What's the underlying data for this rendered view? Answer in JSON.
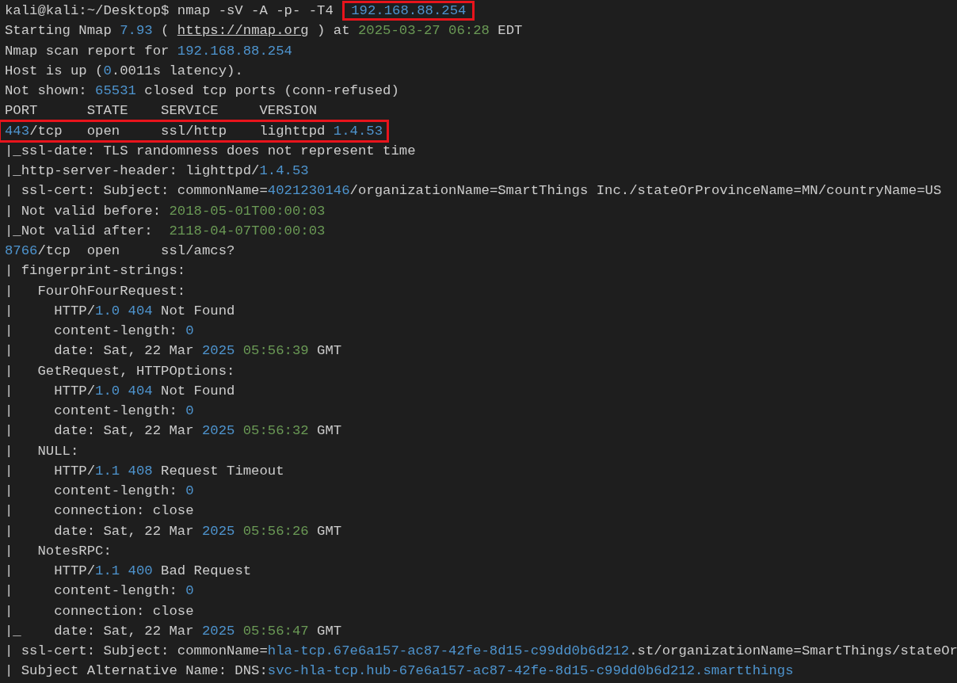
{
  "terminal": {
    "lines": [
      {
        "boxed": false,
        "segments": [
          {
            "text": "kali@kali:~/Desktop$ nmap -sV -A -p- -T4 ",
            "kind": "plain"
          },
          {
            "text": "192.168.88.254",
            "kind": "number",
            "boxed": true
          }
        ]
      },
      {
        "boxed": false,
        "segments": [
          {
            "text": "Starting Nmap ",
            "kind": "plain"
          },
          {
            "text": "7.93",
            "kind": "number"
          },
          {
            "text": " ( ",
            "kind": "plain"
          },
          {
            "text": "https://nmap.org",
            "kind": "link"
          },
          {
            "text": " ) at ",
            "kind": "plain"
          },
          {
            "text": "2025-03-27 06:28",
            "kind": "date"
          },
          {
            "text": " EDT",
            "kind": "plain"
          }
        ]
      },
      {
        "boxed": false,
        "segments": [
          {
            "text": "Nmap scan report for ",
            "kind": "plain"
          },
          {
            "text": "192.168.88.254",
            "kind": "number"
          }
        ]
      },
      {
        "boxed": false,
        "segments": [
          {
            "text": "Host is up (",
            "kind": "plain"
          },
          {
            "text": "0",
            "kind": "number"
          },
          {
            "text": ".0011s latency).",
            "kind": "plain"
          }
        ]
      },
      {
        "boxed": false,
        "segments": [
          {
            "text": "Not shown: ",
            "kind": "plain"
          },
          {
            "text": "65531",
            "kind": "number"
          },
          {
            "text": " closed tcp ports (conn-refused)",
            "kind": "plain"
          }
        ]
      },
      {
        "boxed": false,
        "segments": [
          {
            "text": "PORT      STATE    SERVICE     VERSION",
            "kind": "plain"
          }
        ]
      },
      {
        "boxed": true,
        "segments": [
          {
            "text": "443",
            "kind": "number"
          },
          {
            "text": "/tcp   open     ssl/http    lighttpd ",
            "kind": "plain"
          },
          {
            "text": "1.4.53",
            "kind": "number"
          }
        ]
      },
      {
        "boxed": false,
        "segments": [
          {
            "text": "|_ssl-date: TLS randomness does not represent time",
            "kind": "plain"
          }
        ]
      },
      {
        "boxed": false,
        "segments": [
          {
            "text": "|_http-server-header: lighttpd/",
            "kind": "plain"
          },
          {
            "text": "1.4.53",
            "kind": "number"
          }
        ]
      },
      {
        "boxed": false,
        "segments": [
          {
            "text": "| ssl-cert: Subject: commonName=",
            "kind": "plain"
          },
          {
            "text": "4021230146",
            "kind": "number"
          },
          {
            "text": "/organizationName=SmartThings Inc./stateOrProvinceName=MN/countryName=US",
            "kind": "plain"
          }
        ]
      },
      {
        "boxed": false,
        "segments": [
          {
            "text": "| Not valid before: ",
            "kind": "plain"
          },
          {
            "text": "2018-05-01T00:00:03",
            "kind": "date"
          }
        ]
      },
      {
        "boxed": false,
        "segments": [
          {
            "text": "|_Not valid after:  ",
            "kind": "plain"
          },
          {
            "text": "2118-04-07T00:00:03",
            "kind": "date"
          }
        ]
      },
      {
        "boxed": false,
        "segments": [
          {
            "text": "8766",
            "kind": "number"
          },
          {
            "text": "/tcp  open     ssl/amcs?",
            "kind": "plain"
          }
        ]
      },
      {
        "boxed": false,
        "segments": [
          {
            "text": "| fingerprint-strings:",
            "kind": "plain"
          }
        ]
      },
      {
        "boxed": false,
        "segments": [
          {
            "text": "|   FourOhFourRequest:",
            "kind": "plain"
          }
        ]
      },
      {
        "boxed": false,
        "segments": [
          {
            "text": "|     HTTP/",
            "kind": "plain"
          },
          {
            "text": "1.0 404",
            "kind": "number"
          },
          {
            "text": " Not Found",
            "kind": "plain"
          }
        ]
      },
      {
        "boxed": false,
        "segments": [
          {
            "text": "|     content-length: ",
            "kind": "plain"
          },
          {
            "text": "0",
            "kind": "number"
          }
        ]
      },
      {
        "boxed": false,
        "segments": [
          {
            "text": "|     date: Sat, 22 Mar ",
            "kind": "plain"
          },
          {
            "text": "2025 ",
            "kind": "number"
          },
          {
            "text": "05:56:39",
            "kind": "date"
          },
          {
            "text": " GMT",
            "kind": "plain"
          }
        ]
      },
      {
        "boxed": false,
        "segments": [
          {
            "text": "|   GetRequest, HTTPOptions:",
            "kind": "plain"
          }
        ]
      },
      {
        "boxed": false,
        "segments": [
          {
            "text": "|     HTTP/",
            "kind": "plain"
          },
          {
            "text": "1.0 404",
            "kind": "number"
          },
          {
            "text": " Not Found",
            "kind": "plain"
          }
        ]
      },
      {
        "boxed": false,
        "segments": [
          {
            "text": "|     content-length: ",
            "kind": "plain"
          },
          {
            "text": "0",
            "kind": "number"
          }
        ]
      },
      {
        "boxed": false,
        "segments": [
          {
            "text": "|     date: Sat, 22 Mar ",
            "kind": "plain"
          },
          {
            "text": "2025 ",
            "kind": "number"
          },
          {
            "text": "05:56:32",
            "kind": "date"
          },
          {
            "text": " GMT",
            "kind": "plain"
          }
        ]
      },
      {
        "boxed": false,
        "segments": [
          {
            "text": "|   NULL:",
            "kind": "plain"
          }
        ]
      },
      {
        "boxed": false,
        "segments": [
          {
            "text": "|     HTTP/",
            "kind": "plain"
          },
          {
            "text": "1.1 408",
            "kind": "number"
          },
          {
            "text": " Request Timeout",
            "kind": "plain"
          }
        ]
      },
      {
        "boxed": false,
        "segments": [
          {
            "text": "|     content-length: ",
            "kind": "plain"
          },
          {
            "text": "0",
            "kind": "number"
          }
        ]
      },
      {
        "boxed": false,
        "segments": [
          {
            "text": "|     connection: close",
            "kind": "plain"
          }
        ]
      },
      {
        "boxed": false,
        "segments": [
          {
            "text": "|     date: Sat, 22 Mar ",
            "kind": "plain"
          },
          {
            "text": "2025 ",
            "kind": "number"
          },
          {
            "text": "05:56:26",
            "kind": "date"
          },
          {
            "text": " GMT",
            "kind": "plain"
          }
        ]
      },
      {
        "boxed": false,
        "segments": [
          {
            "text": "|   NotesRPC:",
            "kind": "plain"
          }
        ]
      },
      {
        "boxed": false,
        "segments": [
          {
            "text": "|     HTTP/",
            "kind": "plain"
          },
          {
            "text": "1.1 400",
            "kind": "number"
          },
          {
            "text": " Bad Request",
            "kind": "plain"
          }
        ]
      },
      {
        "boxed": false,
        "segments": [
          {
            "text": "|     content-length: ",
            "kind": "plain"
          },
          {
            "text": "0",
            "kind": "number"
          }
        ]
      },
      {
        "boxed": false,
        "segments": [
          {
            "text": "|     connection: close",
            "kind": "plain"
          }
        ]
      },
      {
        "boxed": false,
        "segments": [
          {
            "text": "|_    date: Sat, 22 Mar ",
            "kind": "plain"
          },
          {
            "text": "2025 ",
            "kind": "number"
          },
          {
            "text": "05:56:47",
            "kind": "date"
          },
          {
            "text": " GMT",
            "kind": "plain"
          }
        ]
      },
      {
        "boxed": false,
        "segments": [
          {
            "text": "| ssl-cert: Subject: commonName=",
            "kind": "plain"
          },
          {
            "text": "hla-tcp.67e6a157-ac87-42fe-8d15-c99dd0b6d212",
            "kind": "number"
          },
          {
            "text": ".st/organizationName=SmartThings/stateOr",
            "kind": "plain"
          }
        ]
      },
      {
        "boxed": false,
        "segments": [
          {
            "text": "| Subject Alternative Name: DNS:",
            "kind": "plain"
          },
          {
            "text": "svc-hla-tcp.hub-67e6a157-ac87-42fe-8d15-c99dd0b6d212.smartthings",
            "kind": "number"
          }
        ]
      }
    ]
  }
}
